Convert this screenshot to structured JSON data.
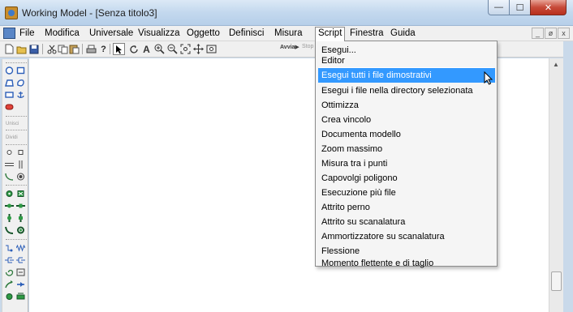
{
  "window": {
    "title": "Working Model - [Senza titolo3]",
    "controls": {
      "minimize": "—",
      "maximize": "☐",
      "close": "✕"
    }
  },
  "menubar": {
    "items": [
      {
        "label": "File"
      },
      {
        "label": "Modifica"
      },
      {
        "label": "Universale"
      },
      {
        "label": "Visualizza"
      },
      {
        "label": "Oggetto"
      },
      {
        "label": "Definisci"
      },
      {
        "label": "Misura"
      },
      {
        "label": "Script"
      },
      {
        "label": "Finestra"
      },
      {
        "label": "Guida"
      }
    ],
    "mdi_controls": {
      "minimize": "_",
      "restore": "ø",
      "close": "x"
    }
  },
  "toolbar": {
    "run_label": "Avvia▶",
    "stop_label": "Stop",
    "icons": [
      "new-icon",
      "open-icon",
      "save-icon",
      "cut-icon",
      "copy-icon",
      "paste-icon",
      "print-icon",
      "help-icon",
      "pointer-icon",
      "rotate-icon",
      "text-icon",
      "zoom-in-icon",
      "zoom-out-icon",
      "zoom-fit-icon",
      "move-icon",
      "pin-icon"
    ]
  },
  "palette": {
    "labels": {
      "join": "Unisci",
      "split": "Dividi"
    }
  },
  "script_menu": {
    "top_items": [
      {
        "label": "Esegui..."
      },
      {
        "label": "Editor"
      }
    ],
    "items": [
      {
        "label": "Esegui tutti i file dimostrativi",
        "highlighted": true
      },
      {
        "label": "Esegui i file nella directory selezionata"
      },
      {
        "label": "Ottimizza"
      },
      {
        "label": "Crea vincolo"
      },
      {
        "label": "Documenta modello"
      },
      {
        "label": "Zoom massimo"
      },
      {
        "label": "Misura tra i punti"
      },
      {
        "label": "Capovolgi poligono"
      },
      {
        "label": "Esecuzione più file"
      },
      {
        "label": "Attrito perno"
      },
      {
        "label": "Attrito su scanalatura"
      },
      {
        "label": "Ammortizzatore su scanalatura"
      },
      {
        "label": "Flessione"
      },
      {
        "label": "Momento flettente e di taglio"
      }
    ]
  },
  "colors": {
    "highlight": "#3399ff",
    "titlebar": "#c3d8ee",
    "close_button": "#c74a39"
  }
}
